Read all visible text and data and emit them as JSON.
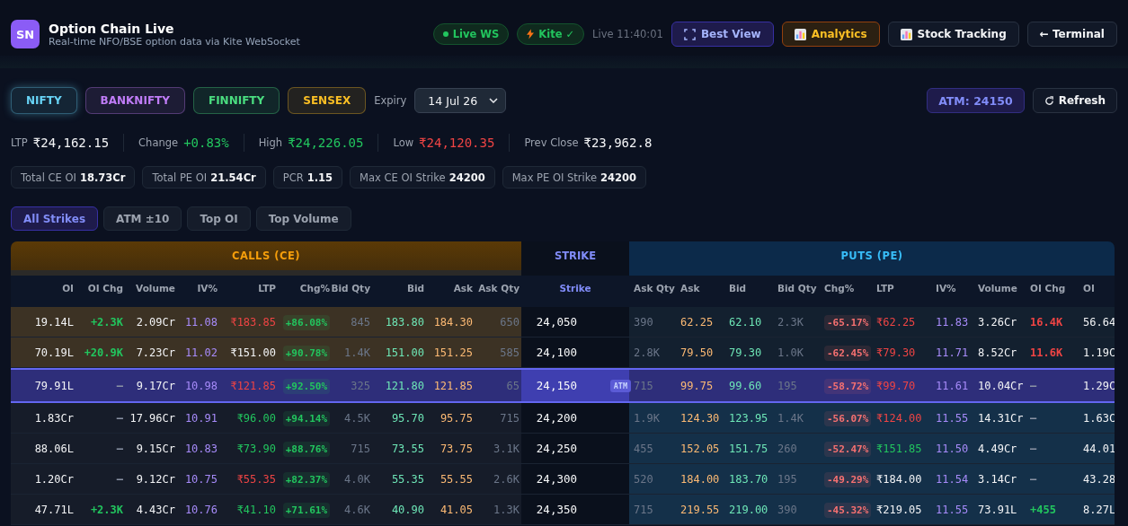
{
  "app": {
    "logo": "SN",
    "title": "Option Chain Live",
    "subtitle": "Real-time NFO/BSE option data via Kite WebSocket"
  },
  "status": [
    {
      "kind": "live",
      "label": "Live WS"
    },
    {
      "kind": "kite",
      "label": "Kite ✓"
    }
  ],
  "clock": "Live 11:40:01",
  "header_buttons": [
    {
      "kind": "view",
      "label": "Best View"
    },
    {
      "kind": "analytics",
      "label": "Analytics"
    },
    {
      "kind": "tracking",
      "label": "Stock Tracking"
    },
    {
      "kind": "back",
      "label": "← Terminal"
    }
  ],
  "indices": [
    {
      "label": "NIFTY",
      "selected": true,
      "color": "#67d3f5"
    },
    {
      "label": "BANKNIFTY",
      "selected": false,
      "color": "#c07cf7"
    },
    {
      "label": "FINNIFTY",
      "selected": false,
      "color": "#4ade80"
    },
    {
      "label": "SENSEX",
      "selected": false,
      "color": "#fbbf24"
    }
  ],
  "expiry": {
    "label": "Expiry",
    "value": "14 Jul 26"
  },
  "atm_badge": "ATM: 24150",
  "refresh": "Refresh",
  "quote": [
    {
      "label": "LTP",
      "value": "₹24,162.15",
      "color": "#f3f4f6"
    },
    {
      "label": "Change",
      "value": "+0.83%",
      "color": "#22c55e"
    },
    {
      "label": "High",
      "value": "₹24,226.05",
      "color": "#22c55e"
    },
    {
      "label": "Low",
      "value": "₹24,120.35",
      "color": "#ef4444"
    },
    {
      "label": "Prev Close",
      "value": "₹23,962.8",
      "color": "#f3f4f6"
    }
  ],
  "summary": [
    {
      "label": "Total CE OI",
      "value": "18.73Cr"
    },
    {
      "label": "Total PE OI",
      "value": "21.54Cr"
    },
    {
      "label": "PCR",
      "value": "1.15"
    },
    {
      "label": "Max CE OI Strike",
      "value": "24200"
    },
    {
      "label": "Max PE OI Strike",
      "value": "24200"
    }
  ],
  "filters": [
    {
      "label": "All Strikes",
      "selected": true
    },
    {
      "label": "ATM ±10",
      "selected": false
    },
    {
      "label": "Top OI",
      "selected": false
    },
    {
      "label": "Top Volume",
      "selected": false
    }
  ],
  "table": {
    "calls_title": "CALLS (CE)",
    "strike_title": "STRIKE",
    "puts_title": "PUTS (PE)",
    "ce_columns": [
      "OI",
      "OI Chg",
      "Volume",
      "IV%",
      "LTP",
      "Chg%",
      "Bid Qty",
      "Bid",
      "Ask",
      "Ask Qty"
    ],
    "strike_column": "Strike",
    "pe_columns": [
      "Ask Qty",
      "Ask",
      "Bid",
      "Bid Qty",
      "Chg%",
      "LTP",
      "IV%",
      "Volume",
      "OI Chg",
      "OI"
    ],
    "atm_label": "ATM",
    "rows": [
      {
        "strike": "24,050",
        "atm": false,
        "ce_itm": true,
        "pe_itm": false,
        "ce": {
          "oi": "19.14L",
          "oi_chg": {
            "value": "+2.3K",
            "color": "#22c55e"
          },
          "volume": "2.09Cr",
          "iv": "11.08",
          "ltp": {
            "value": "₹183.85",
            "color": "#ef4444"
          },
          "chg": {
            "value": "+86.08%",
            "color": "#22c55e"
          },
          "bid_qty": "845",
          "bid": "183.80",
          "ask": "184.30",
          "ask_qty": "650"
        },
        "pe": {
          "ask_qty": "390",
          "ask": "62.25",
          "bid": "62.10",
          "bid_qty": "2.3K",
          "chg": {
            "value": "-65.17%",
            "color": "#f87171"
          },
          "ltp": {
            "value": "₹62.25",
            "color": "#ef4444"
          },
          "iv": "11.83",
          "volume": "3.26Cr",
          "oi_chg": {
            "value": "16.4K",
            "color": "#ef4444"
          },
          "oi": "56.64"
        }
      },
      {
        "strike": "24,100",
        "atm": false,
        "ce_itm": true,
        "pe_itm": false,
        "ce": {
          "oi": "70.19L",
          "oi_chg": {
            "value": "+20.9K",
            "color": "#22c55e"
          },
          "volume": "7.23Cr",
          "iv": "11.02",
          "ltp": {
            "value": "₹151.00",
            "color": "#f3f4f6"
          },
          "chg": {
            "value": "+90.78%",
            "color": "#22c55e"
          },
          "bid_qty": "1.4K",
          "bid": "151.00",
          "ask": "151.25",
          "ask_qty": "585"
        },
        "pe": {
          "ask_qty": "2.8K",
          "ask": "79.50",
          "bid": "79.30",
          "bid_qty": "1.0K",
          "chg": {
            "value": "-62.45%",
            "color": "#f87171"
          },
          "ltp": {
            "value": "₹79.30",
            "color": "#ef4444"
          },
          "iv": "11.71",
          "volume": "8.52Cr",
          "oi_chg": {
            "value": "11.6K",
            "color": "#ef4444"
          },
          "oi": "1.19C"
        }
      },
      {
        "strike": "24,150",
        "atm": true,
        "ce_itm": false,
        "pe_itm": false,
        "ce": {
          "oi": "79.91L",
          "oi_chg": {
            "value": "—",
            "color": "#8b93a5"
          },
          "volume": "9.17Cr",
          "iv": "10.98",
          "ltp": {
            "value": "₹121.85",
            "color": "#ef4444"
          },
          "chg": {
            "value": "+92.50%",
            "color": "#22c55e"
          },
          "bid_qty": "325",
          "bid": "121.80",
          "ask": "121.85",
          "ask_qty": "65"
        },
        "pe": {
          "ask_qty": "715",
          "ask": "99.75",
          "bid": "99.60",
          "bid_qty": "195",
          "chg": {
            "value": "-58.72%",
            "color": "#f87171"
          },
          "ltp": {
            "value": "₹99.70",
            "color": "#ef4444"
          },
          "iv": "11.61",
          "volume": "10.04Cr",
          "oi_chg": {
            "value": "—",
            "color": "#8b93a5"
          },
          "oi": "1.29C"
        }
      },
      {
        "strike": "24,200",
        "atm": false,
        "ce_itm": false,
        "pe_itm": true,
        "ce": {
          "oi": "1.83Cr",
          "oi_chg": {
            "value": "—",
            "color": "#8b93a5"
          },
          "volume": "17.96Cr",
          "iv": "10.91",
          "ltp": {
            "value": "₹96.00",
            "color": "#22c55e"
          },
          "chg": {
            "value": "+94.14%",
            "color": "#22c55e"
          },
          "bid_qty": "4.5K",
          "bid": "95.70",
          "ask": "95.75",
          "ask_qty": "715"
        },
        "pe": {
          "ask_qty": "1.9K",
          "ask": "124.30",
          "bid": "123.95",
          "bid_qty": "1.4K",
          "chg": {
            "value": "-56.07%",
            "color": "#f87171"
          },
          "ltp": {
            "value": "₹124.00",
            "color": "#ef4444"
          },
          "iv": "11.55",
          "volume": "14.31Cr",
          "oi_chg": {
            "value": "—",
            "color": "#8b93a5"
          },
          "oi": "1.63C"
        }
      },
      {
        "strike": "24,250",
        "atm": false,
        "ce_itm": false,
        "pe_itm": true,
        "ce": {
          "oi": "88.06L",
          "oi_chg": {
            "value": "—",
            "color": "#8b93a5"
          },
          "volume": "9.15Cr",
          "iv": "10.83",
          "ltp": {
            "value": "₹73.90",
            "color": "#22c55e"
          },
          "chg": {
            "value": "+88.76%",
            "color": "#22c55e"
          },
          "bid_qty": "715",
          "bid": "73.55",
          "ask": "73.75",
          "ask_qty": "3.1K"
        },
        "pe": {
          "ask_qty": "455",
          "ask": "152.05",
          "bid": "151.75",
          "bid_qty": "260",
          "chg": {
            "value": "-52.47%",
            "color": "#f87171"
          },
          "ltp": {
            "value": "₹151.85",
            "color": "#22c55e"
          },
          "iv": "11.50",
          "volume": "4.49Cr",
          "oi_chg": {
            "value": "—",
            "color": "#8b93a5"
          },
          "oi": "44.01"
        }
      },
      {
        "strike": "24,300",
        "atm": false,
        "ce_itm": false,
        "pe_itm": true,
        "ce": {
          "oi": "1.20Cr",
          "oi_chg": {
            "value": "—",
            "color": "#8b93a5"
          },
          "volume": "9.12Cr",
          "iv": "10.75",
          "ltp": {
            "value": "₹55.35",
            "color": "#ef4444"
          },
          "chg": {
            "value": "+82.37%",
            "color": "#22c55e"
          },
          "bid_qty": "4.0K",
          "bid": "55.35",
          "ask": "55.55",
          "ask_qty": "2.6K"
        },
        "pe": {
          "ask_qty": "520",
          "ask": "184.00",
          "bid": "183.70",
          "bid_qty": "195",
          "chg": {
            "value": "-49.29%",
            "color": "#f87171"
          },
          "ltp": {
            "value": "₹184.00",
            "color": "#f3f4f6"
          },
          "iv": "11.54",
          "volume": "3.14Cr",
          "oi_chg": {
            "value": "—",
            "color": "#8b93a5"
          },
          "oi": "43.28"
        }
      },
      {
        "strike": "24,350",
        "atm": false,
        "ce_itm": false,
        "pe_itm": true,
        "ce": {
          "oi": "47.71L",
          "oi_chg": {
            "value": "+2.3K",
            "color": "#22c55e"
          },
          "volume": "4.43Cr",
          "iv": "10.76",
          "ltp": {
            "value": "₹41.10",
            "color": "#22c55e"
          },
          "chg": {
            "value": "+71.61%",
            "color": "#22c55e"
          },
          "bid_qty": "4.6K",
          "bid": "40.90",
          "ask": "41.05",
          "ask_qty": "1.3K"
        },
        "pe": {
          "ask_qty": "715",
          "ask": "219.55",
          "bid": "219.00",
          "bid_qty": "390",
          "chg": {
            "value": "-45.32%",
            "color": "#f87171"
          },
          "ltp": {
            "value": "₹219.05",
            "color": "#f3f4f6"
          },
          "iv": "11.55",
          "volume": "73.91L",
          "oi_chg": {
            "value": "+455",
            "color": "#22c55e"
          },
          "oi": "8.27L"
        }
      }
    ]
  }
}
